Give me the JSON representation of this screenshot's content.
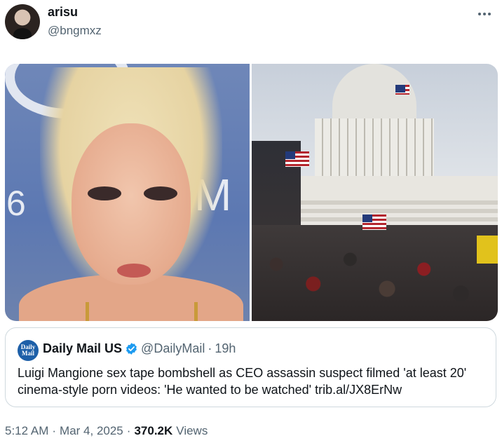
{
  "author": {
    "display_name": "arisu",
    "handle": "@bngmxz"
  },
  "media": {
    "left_photo_sign_text": "M",
    "left_photo_sign_number": "6"
  },
  "quoted_tweet": {
    "avatar_text": "Daily Mail",
    "display_name": "Daily Mail US",
    "handle": "@DailyMail",
    "separator": "·",
    "time": "19h",
    "text": "Luigi Mangione sex tape bombshell as CEO assassin suspect filmed 'at least 20' cinema-style porn videos: 'He wanted to be watched' trib.al/JX8ErNw"
  },
  "meta": {
    "time": "5:12 AM",
    "dot1": "·",
    "date": "Mar 4, 2025",
    "dot2": "·",
    "views_count": "370.2K",
    "views_label": "Views"
  },
  "colors": {
    "verified_badge": "#1d9bf0",
    "secondary_text": "#536471",
    "border": "#cfd9de"
  },
  "icons": {
    "more": "more-dots-icon",
    "verified": "verified-badge-icon"
  }
}
